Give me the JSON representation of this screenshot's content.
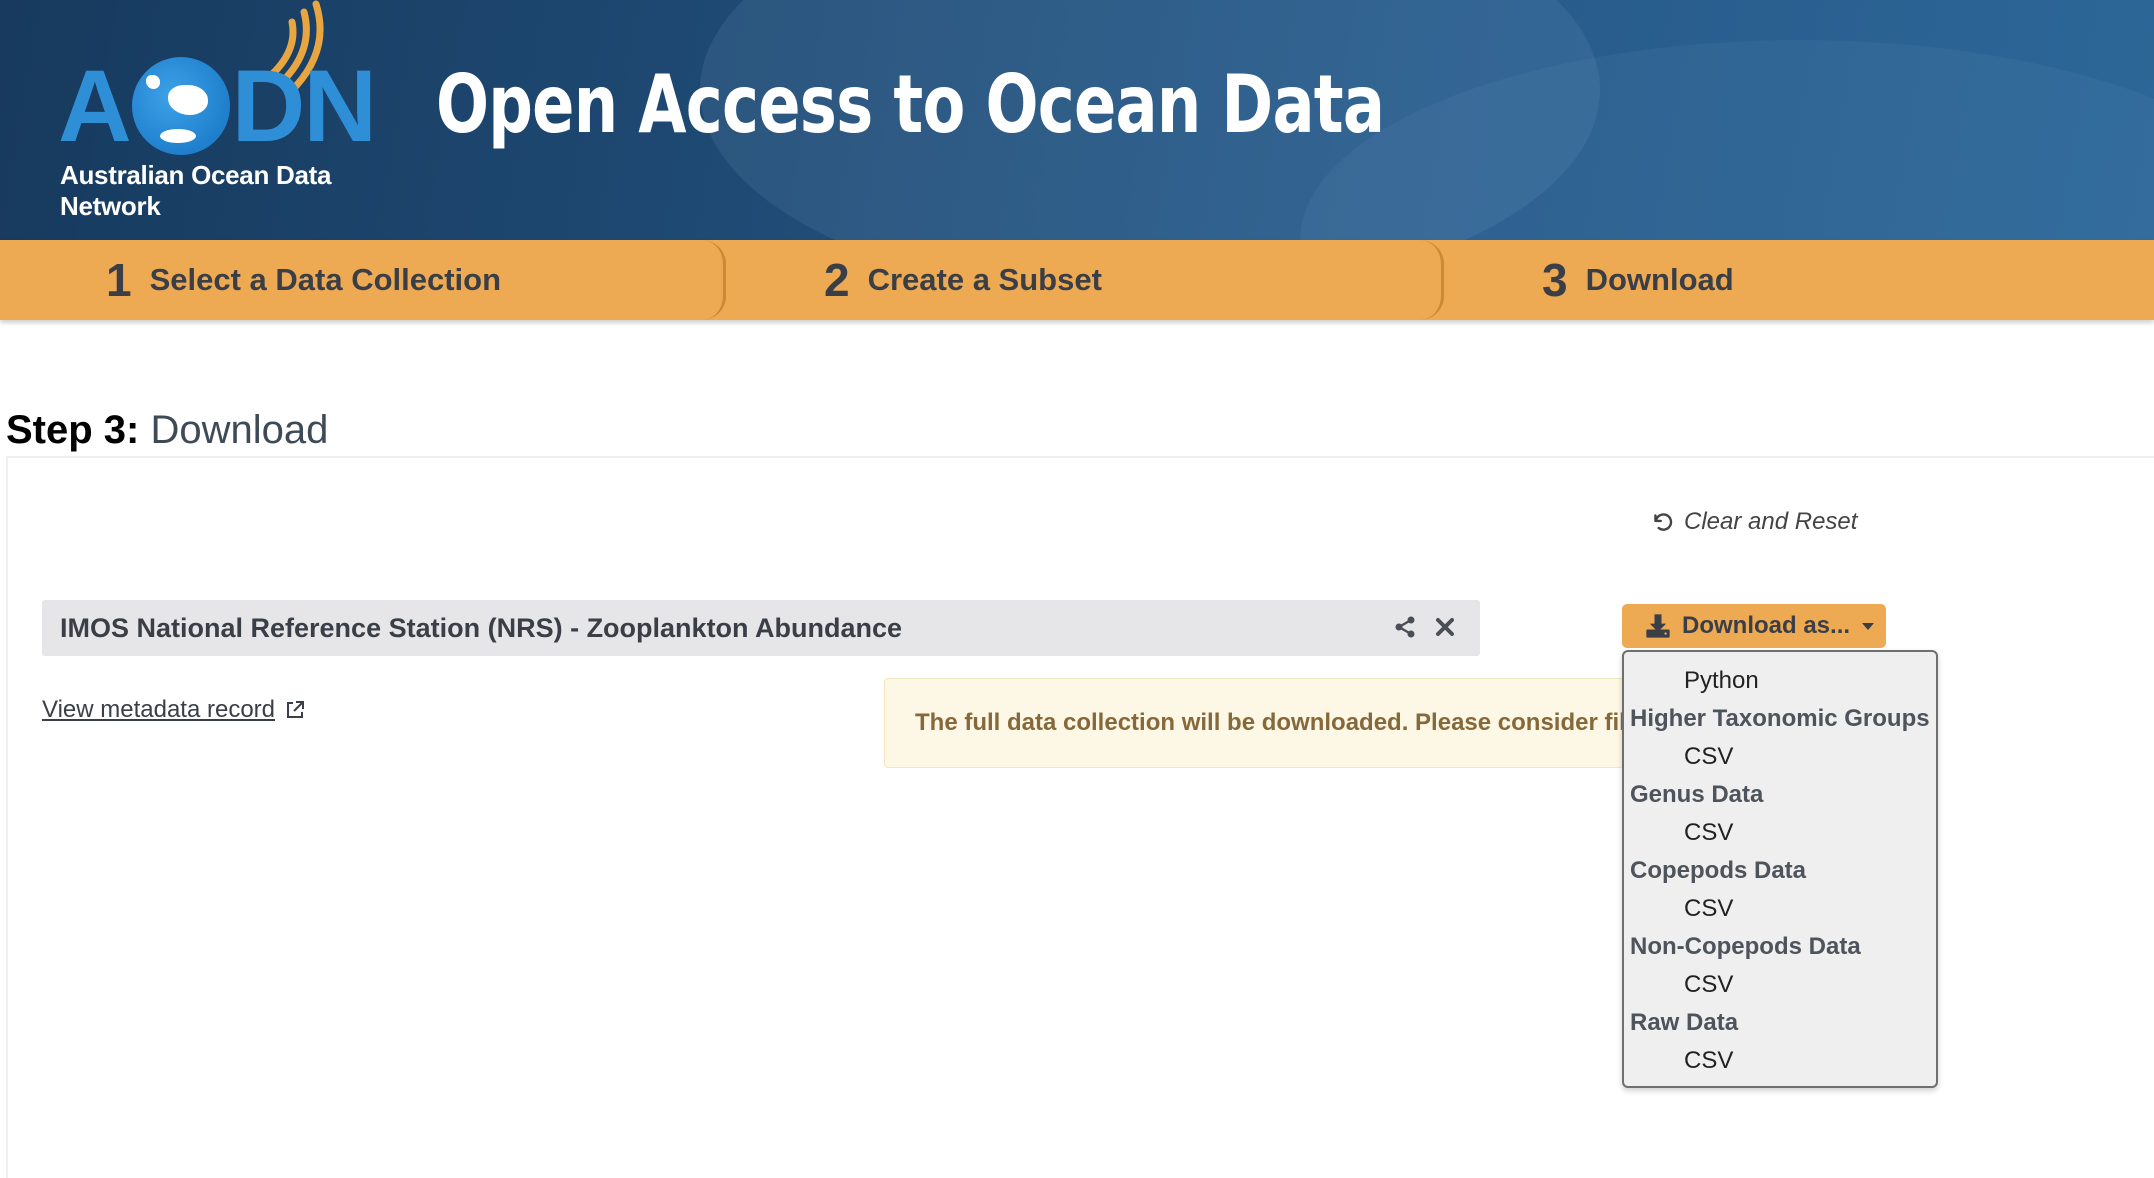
{
  "header": {
    "logo_letters": [
      "A",
      "DN"
    ],
    "logo_subtitle": "Australian Ocean Data Network",
    "site_title": "Open Access to Ocean Data"
  },
  "steps": [
    {
      "number": "1",
      "label": "Select a Data Collection"
    },
    {
      "number": "2",
      "label": "Create a Subset"
    },
    {
      "number": "3",
      "label": "Download"
    }
  ],
  "page": {
    "heading_bold": "Step 3:",
    "heading_light": "Download",
    "clear_reset": "Clear and Reset"
  },
  "collection": {
    "title": "IMOS National Reference Station (NRS) - Zooplankton Abundance",
    "metadata_link": "View metadata record"
  },
  "alert": {
    "text": "The full data collection will be downloaded. Please consider filtering the collection."
  },
  "download": {
    "button_label": "Download as...",
    "menu": [
      {
        "type": "item",
        "label": "Python"
      },
      {
        "type": "group",
        "label": "Higher Taxonomic Groups"
      },
      {
        "type": "item",
        "label": "CSV"
      },
      {
        "type": "group",
        "label": "Genus Data"
      },
      {
        "type": "item",
        "label": "CSV"
      },
      {
        "type": "group",
        "label": "Copepods Data"
      },
      {
        "type": "item",
        "label": "CSV"
      },
      {
        "type": "group",
        "label": "Non-Copepods Data"
      },
      {
        "type": "item",
        "label": "CSV"
      },
      {
        "type": "group",
        "label": "Raw Data"
      },
      {
        "type": "item",
        "label": "CSV"
      }
    ]
  },
  "colors": {
    "header_dark": "#173a5e",
    "accent_orange": "#eea953",
    "logo_blue": "#2f8fd6",
    "alert_bg": "#fcf8e5",
    "alert_text": "#86683a"
  },
  "icons": [
    "globe-logo-icon",
    "signal-arcs-icon",
    "undo-icon",
    "share-icon",
    "close-icon",
    "external-link-icon",
    "download-icon",
    "caret-down-icon"
  ]
}
